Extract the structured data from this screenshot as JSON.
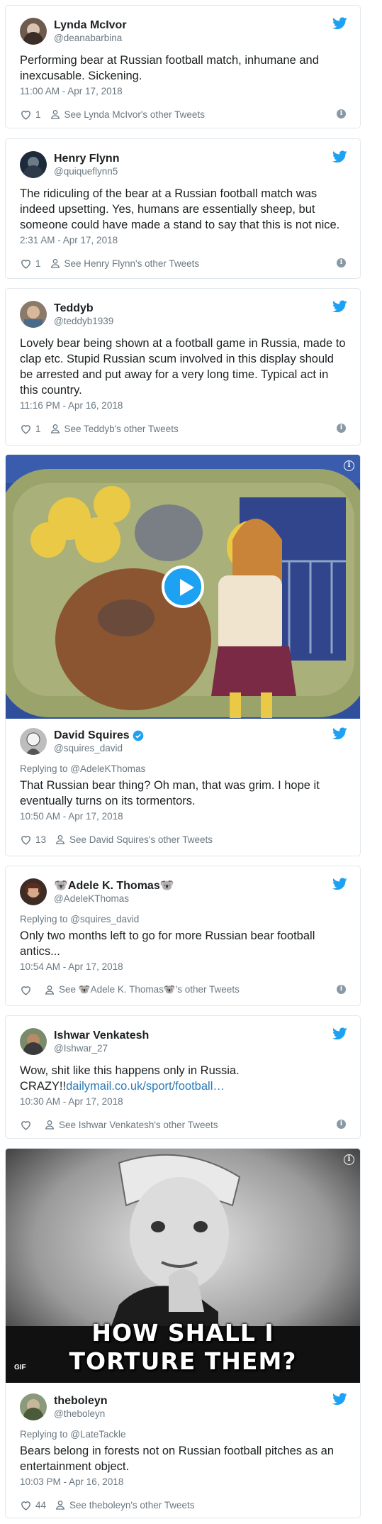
{
  "tweets": [
    {
      "name": "Lynda McIvor",
      "handle": "@deanabarbina",
      "text": "Performing bear at Russian football match, inhumane and inexcusable. Sickening.",
      "time": "11:00 AM - Apr 17, 2018",
      "likes": "1",
      "other": "See Lynda McIvor's other Tweets"
    },
    {
      "name": "Henry Flynn",
      "handle": "@quiqueflynn5",
      "text": "The ridiculing of the bear at a Russian football match was indeed upsetting. Yes, humans are essentially sheep, but someone could have made a stand to say that this is not nice.",
      "time": "2:31 AM - Apr 17, 2018",
      "likes": "1",
      "other": "See Henry Flynn's other Tweets"
    },
    {
      "name": "Teddyb",
      "handle": "@teddyb1939",
      "text": "Lovely bear being shown at a football game in Russia, made to clap etc. Stupid Russian scum involved in this display should be arrested and put away for a very long time. Typical act in this country.",
      "time": "11:16 PM - Apr 16, 2018",
      "likes": "1",
      "other": "See Teddyb's other Tweets"
    },
    {
      "name": "David Squires",
      "handle": "@squires_david",
      "reply": "Replying to @AdeleKThomas",
      "text": "That Russian bear thing? Oh man, that was grim. I hope it eventually turns on its tormentors.",
      "time": "10:50 AM - Apr 17, 2018",
      "likes": "13",
      "other": "See David Squires's other Tweets"
    },
    {
      "name": "🐨Adele K. Thomas🐨",
      "handle": "@AdeleKThomas",
      "reply": "Replying to @squires_david",
      "text": "Only two months left to go for more Russian bear football antics...",
      "time": "10:54 AM - Apr 17, 2018",
      "likes": "",
      "other": "See 🐨Adele K. Thomas🐨's other Tweets"
    },
    {
      "name": "Ishwar Venkatesh",
      "handle": "@Ishwar_27",
      "text": "Wow, shit like this happens only in Russia. CRAZY!!",
      "link": "dailymail.co.uk/sport/football…",
      "time": "10:30 AM - Apr 17, 2018",
      "likes": "",
      "other": "See Ishwar Venkatesh's other Tweets"
    },
    {
      "name": "theboleyn",
      "handle": "@theboleyn",
      "reply": "Replying to @LateTackle",
      "text": "Bears belong in forests not on Russian football pitches as an entertainment object.",
      "time": "10:03 PM - Apr 16, 2018",
      "likes": "44",
      "other": "See theboleyn's other Tweets"
    }
  ],
  "gif": {
    "badge": "GIF",
    "caption1": "HOW SHALL I",
    "caption2": "TORTURE THEM?"
  },
  "info_glyph": "i",
  "colors": {
    "twitter_blue": "#1da1f2",
    "meta_grey": "#697882",
    "link": "#2b7bb9",
    "border": "#e1e8ed"
  }
}
